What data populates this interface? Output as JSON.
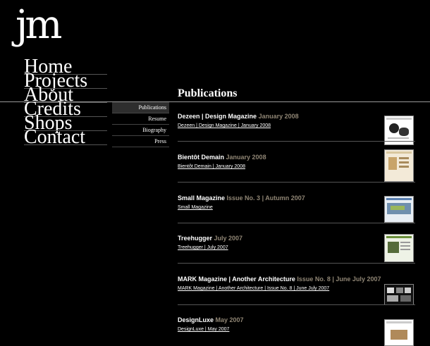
{
  "logo": "jm",
  "main_nav": [
    "Home",
    "Projects",
    "About",
    "Credits",
    "Shops",
    "Contact"
  ],
  "sub_nav": {
    "items": [
      "Publications",
      "Resume",
      "Biography",
      "Press"
    ],
    "active": "Publications"
  },
  "section_title": "Publications",
  "publications": [
    {
      "title": "Dezeen | Design Magazine",
      "date": "January 2008",
      "link": "Dezeen | Design Magazine | January 2008"
    },
    {
      "title": "Bientôt Demain",
      "date": "January 2008",
      "link": "Bientôt Demain | January 2008"
    },
    {
      "title": "Small Magazine",
      "date": "Issue No. 3 | Autumn 2007",
      "link": "Small Magazine"
    },
    {
      "title": "Treehugger",
      "date": "July 2007",
      "link": "Treehugger | July 2007"
    },
    {
      "title": "MARK Magazine | Another Architecture",
      "date": "Issue No. 8 | June July 2007",
      "link": "MARK Magazine | Another Architecture | Issue No. 8 | June July 2007"
    },
    {
      "title": "DesignLuxe",
      "date": "May 2007",
      "link": "DesignLuxe | May 2007"
    }
  ],
  "colors": {
    "background": "#000000",
    "text": "#ffffff",
    "date_accent": "#8f8574",
    "active_subnav": "#2e2e2e"
  }
}
